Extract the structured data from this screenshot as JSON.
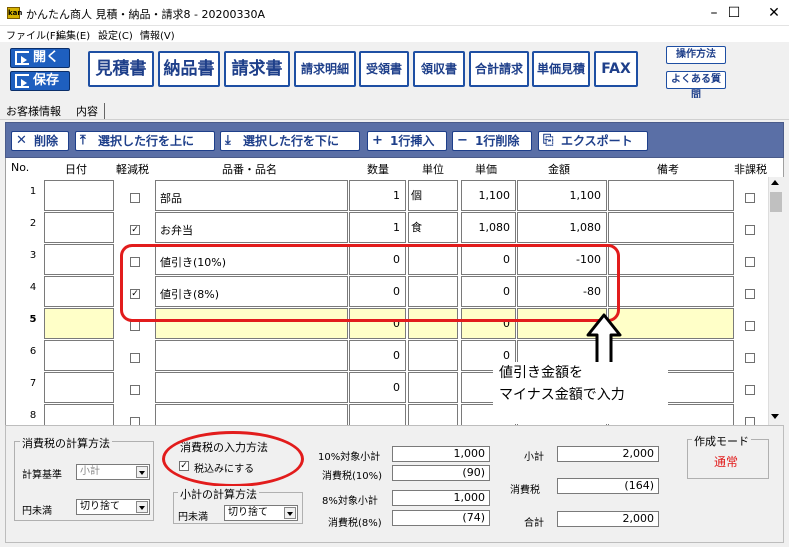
{
  "window": {
    "title": "かんたん商人 見積・納品・請求8 - 20200330A",
    "icon_label": "kan",
    "controls": [
      "–",
      "☐",
      "✕"
    ]
  },
  "menu": [
    "ファイル(F)",
    "編集(E)",
    "設定(C)",
    "情報(V)"
  ],
  "toolbar": {
    "open_label": "開く",
    "save_label": "保存",
    "doc_buttons": [
      "見積書",
      "納品書",
      "請求書",
      "請求明細",
      "受領書",
      "領収書",
      "合計請求",
      "単価見積",
      "FAX"
    ],
    "help_buttons": [
      "操作方法",
      "よくある質問"
    ]
  },
  "tabs": [
    "お客様情報",
    "内容"
  ],
  "grid_toolbar": [
    {
      "label": "削除",
      "icon": "✕"
    },
    {
      "label": "選択した行を上に",
      "icon": "⤒"
    },
    {
      "label": "選択した行を下に",
      "icon": "⤓"
    },
    {
      "label": "1行挿入",
      "icon": "+"
    },
    {
      "label": "1行削除",
      "icon": "−"
    },
    {
      "label": "エクスポート",
      "icon": "⎘"
    }
  ],
  "grid": {
    "headers": {
      "no": "No.",
      "date": "日付",
      "reduced": "軽減税",
      "item": "品番・品名",
      "qty": "数量",
      "unit": "単位",
      "price": "単価",
      "amount": "金額",
      "note": "備考",
      "nontax": "非課税"
    },
    "rows": [
      {
        "no": "1",
        "reduced": false,
        "item": "部品",
        "qty": "1",
        "unit": "個",
        "price": "1,100",
        "amount": "1,100"
      },
      {
        "no": "2",
        "reduced": true,
        "item": "お弁当",
        "qty": "1",
        "unit": "食",
        "price": "1,080",
        "amount": "1,080"
      },
      {
        "no": "3",
        "reduced": false,
        "item": "値引き(10%)",
        "qty": "0",
        "unit": "",
        "price": "0",
        "amount": "-100"
      },
      {
        "no": "4",
        "reduced": true,
        "item": "値引き(8%)",
        "qty": "0",
        "unit": "",
        "price": "0",
        "amount": "-80"
      },
      {
        "no": "5",
        "reduced": false,
        "item": "",
        "qty": "0",
        "unit": "",
        "price": "0",
        "amount": ""
      },
      {
        "no": "6",
        "reduced": false,
        "item": "",
        "qty": "0",
        "unit": "",
        "price": "0",
        "amount": ""
      },
      {
        "no": "7",
        "reduced": false,
        "item": "",
        "qty": "0",
        "unit": "",
        "price": "",
        "amount": ""
      },
      {
        "no": "8",
        "reduced": false,
        "item": "",
        "qty": "",
        "unit": "",
        "price": "",
        "amount": ""
      }
    ]
  },
  "annotation": {
    "line1": "値引き金額を",
    "line2": "マイナス金額で入力",
    "color": "#e21c1c"
  },
  "bottom": {
    "tax_calc": {
      "title": "消費税の計算方法",
      "basis_label": "計算基準",
      "basis_value": "小計",
      "rounding_label": "円未満",
      "rounding_value": "切り捨て"
    },
    "tax_input": {
      "title": "消費税の入力方法",
      "checkbox_label": "税込みにする",
      "checked": true
    },
    "subtotal_calc": {
      "title": "小計の計算方法",
      "rounding_label": "円未満",
      "rounding_value": "切り捨て"
    },
    "sums": [
      {
        "label": "10%対象小計",
        "value": "1,000"
      },
      {
        "label": "消費税(10%)",
        "value": "(90)"
      },
      {
        "label": "8%対象小計",
        "value": "1,000"
      },
      {
        "label": "消費税(8%)",
        "value": "(74)"
      }
    ],
    "totals": [
      {
        "label": "小計",
        "value": "2,000"
      },
      {
        "label": "消費税",
        "value": "(164)"
      },
      {
        "label": "合計",
        "value": "2,000"
      }
    ],
    "mode": {
      "title": "作成モード",
      "value": "通常",
      "color": "#e21c1c"
    }
  }
}
